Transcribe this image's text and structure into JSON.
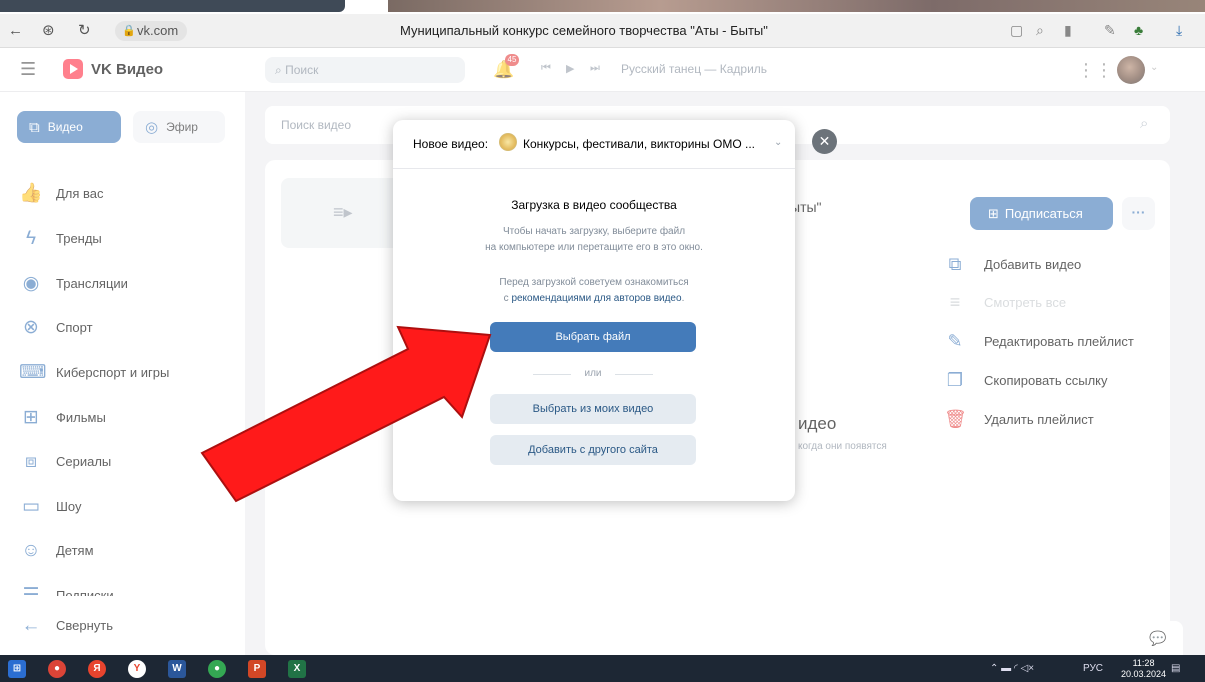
{
  "browser": {
    "url": "vk.com",
    "page_title": "Муниципальный конкурс семейного творчества \"Аты - Быты\""
  },
  "header": {
    "logo_text": "VK Видео",
    "search_placeholder": "Поиск",
    "notifications_count": "45",
    "now_playing": "Русский танец — Кадриль"
  },
  "sidebar": {
    "tabs": [
      {
        "label": "Видео",
        "icon": "video-upload-icon"
      },
      {
        "label": "Эфир",
        "icon": "live-icon"
      }
    ],
    "items": [
      {
        "label": "Для вас",
        "icon": "thumb-up-icon"
      },
      {
        "label": "Тренды",
        "icon": "lightning-icon"
      },
      {
        "label": "Трансляции",
        "icon": "broadcast-icon"
      },
      {
        "label": "Спорт",
        "icon": "ball-icon"
      },
      {
        "label": "Киберспорт и игры",
        "icon": "gamepad-icon"
      },
      {
        "label": "Фильмы",
        "icon": "film-icon"
      },
      {
        "label": "Сериалы",
        "icon": "series-icon"
      },
      {
        "label": "Шоу",
        "icon": "tv-icon"
      },
      {
        "label": "Детям",
        "icon": "kids-icon"
      },
      {
        "label": "Подписки",
        "icon": "subscriptions-icon"
      },
      {
        "label": "Свернуть",
        "icon": "arrow-left-icon"
      }
    ]
  },
  "content": {
    "search_placeholder": "Поиск видео",
    "playlist_title_tail": "ыты\"",
    "subscribe_label": "Подписаться",
    "empty_title_tail": "идео",
    "empty_sub_tail": "когда они появятся",
    "context_menu": [
      {
        "label": "Добавить видео",
        "icon": "add-video-icon",
        "state": "normal"
      },
      {
        "label": "Смотреть все",
        "icon": "playlist-icon",
        "state": "disabled"
      },
      {
        "label": "Редактировать плейлист",
        "icon": "pencil-icon",
        "state": "normal"
      },
      {
        "label": "Скопировать ссылку",
        "icon": "copy-icon",
        "state": "normal"
      },
      {
        "label": "Удалить плейлист",
        "icon": "trash-icon",
        "state": "danger"
      }
    ]
  },
  "modal": {
    "head_label": "Новое видео:",
    "community": "Конкурсы, фестивали, викторины ОМО ...",
    "title": "Загрузка в видео сообщества",
    "text1_line1": "Чтобы начать загрузку, выберите файл",
    "text1_line2": "на компьютере или перетащите его в это окно.",
    "text2_line1": "Перед загрузкой советуем ознакомиться",
    "text2_prefix": "с ",
    "text2_link": "рекомендациями для авторов видео",
    "text2_suffix": ".",
    "primary_button": "Выбрать файл",
    "or_label": "или",
    "choose_mine_button": "Выбрать из моих видео",
    "add_other_site_button": "Добавить с другого сайта"
  },
  "taskbar": {
    "lang": "РУС",
    "time": "11:28",
    "date": "20.03.2024"
  },
  "colors": {
    "accent": "#447bba",
    "arrow": "#ff1a1a",
    "danger": "#e64646"
  }
}
